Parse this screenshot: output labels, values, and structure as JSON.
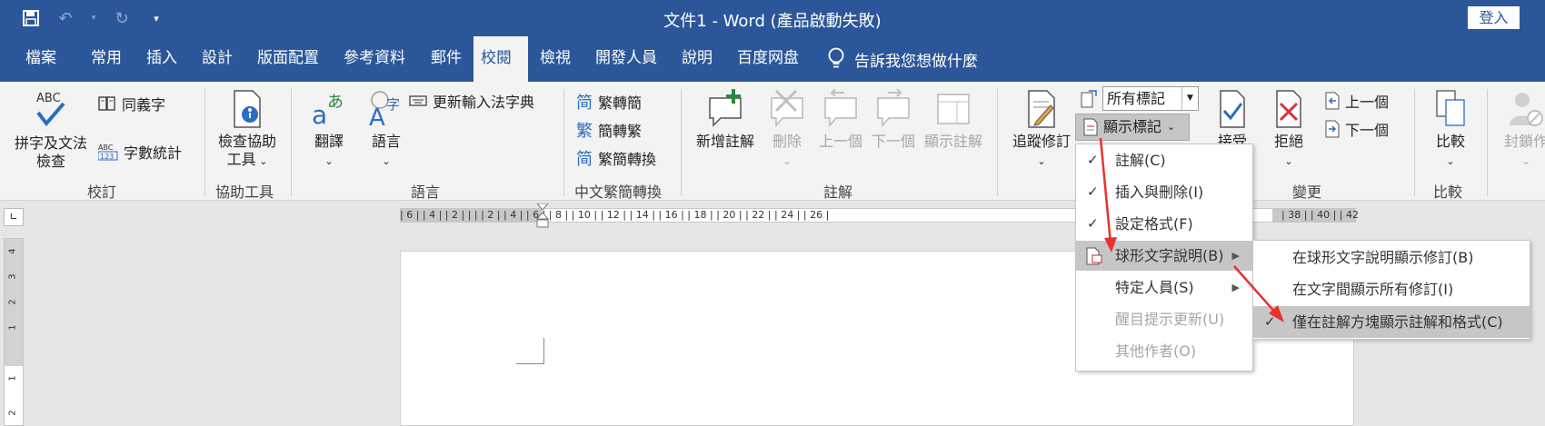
{
  "titlebar": {
    "title": "文件1 - Word (產品啟動失敗)",
    "login": "登入"
  },
  "tabs": [
    "檔案",
    "常用",
    "插入",
    "設計",
    "版面配置",
    "參考資料",
    "郵件",
    "校閱",
    "檢視",
    "開發人員",
    "說明",
    "百度网盘"
  ],
  "active_tab": "校閱",
  "tell_me": "告訴我您想做什麼",
  "ribbon": {
    "proofing": {
      "spelling": "拼字及文法",
      "spelling2": "檢查",
      "thesaurus": "同義字",
      "word_count": "字數統計",
      "group": "校訂"
    },
    "accessibility": {
      "check": "檢查協助",
      "check2": "工具",
      "group": "協助工具"
    },
    "language": {
      "translate": "翻譯",
      "language": "語言",
      "update_ime": "更新輸入法字典",
      "group": "語言"
    },
    "chinese": {
      "t2s": "繁轉簡",
      "s2t": "簡轉繁",
      "convert": "繁簡轉換",
      "group": "中文繁簡轉換"
    },
    "comments": {
      "new": "新增註解",
      "delete": "刪除",
      "prev": "上一個",
      "next": "下一個",
      "show": "顯示註解",
      "group": "註解"
    },
    "tracking": {
      "track": "追蹤修訂",
      "markup_select": "所有標記",
      "show_markup": "顯示標記"
    },
    "changes": {
      "accept": "接受",
      "reject": "拒絕",
      "prev": "上一個",
      "next": "下一個",
      "group": "變更"
    },
    "compare": {
      "compare": "比較",
      "group": "比較"
    },
    "protect": {
      "block": "封鎖作"
    }
  },
  "ruler_numbers": "| 6 |   | 4 |   | 2 |   |      |   | 2 |   | 4 |   | 6 |   | 8 |   | 10 |  | 12 |  | 14 |  | 16 |  | 18 |  | 20 |  | 22 |  | 24 |  | 26 |",
  "ruler_numbers_right": "| 38 |  | 40 |  | 42",
  "vruler_numbers": [
    "4",
    "3",
    "2",
    "1",
    "1",
    "2"
  ],
  "menu": {
    "items": [
      {
        "label": "註解(C)",
        "checked": true
      },
      {
        "label": "插入與刪除(I)",
        "checked": true
      },
      {
        "label": "設定格式(F)",
        "checked": true
      },
      {
        "label": "球形文字說明(B)",
        "checked": false
      },
      {
        "label": "特定人員(S)",
        "checked": false
      },
      {
        "label": "醒目提示更新(U)",
        "checked": false
      },
      {
        "label": "其他作者(O)",
        "checked": false
      }
    ]
  },
  "submenu": {
    "items": [
      {
        "label": "在球形文字說明顯示修訂(B)"
      },
      {
        "label": "在文字間顯示所有修訂(I)"
      },
      {
        "label": "僅在註解方塊顯示註解和格式(C)"
      }
    ]
  },
  "colors": {
    "brand": "#2b579a",
    "ribbon": "#f3f3f3",
    "highlight": "#c6c6c6",
    "arrow": "#e8322c"
  }
}
